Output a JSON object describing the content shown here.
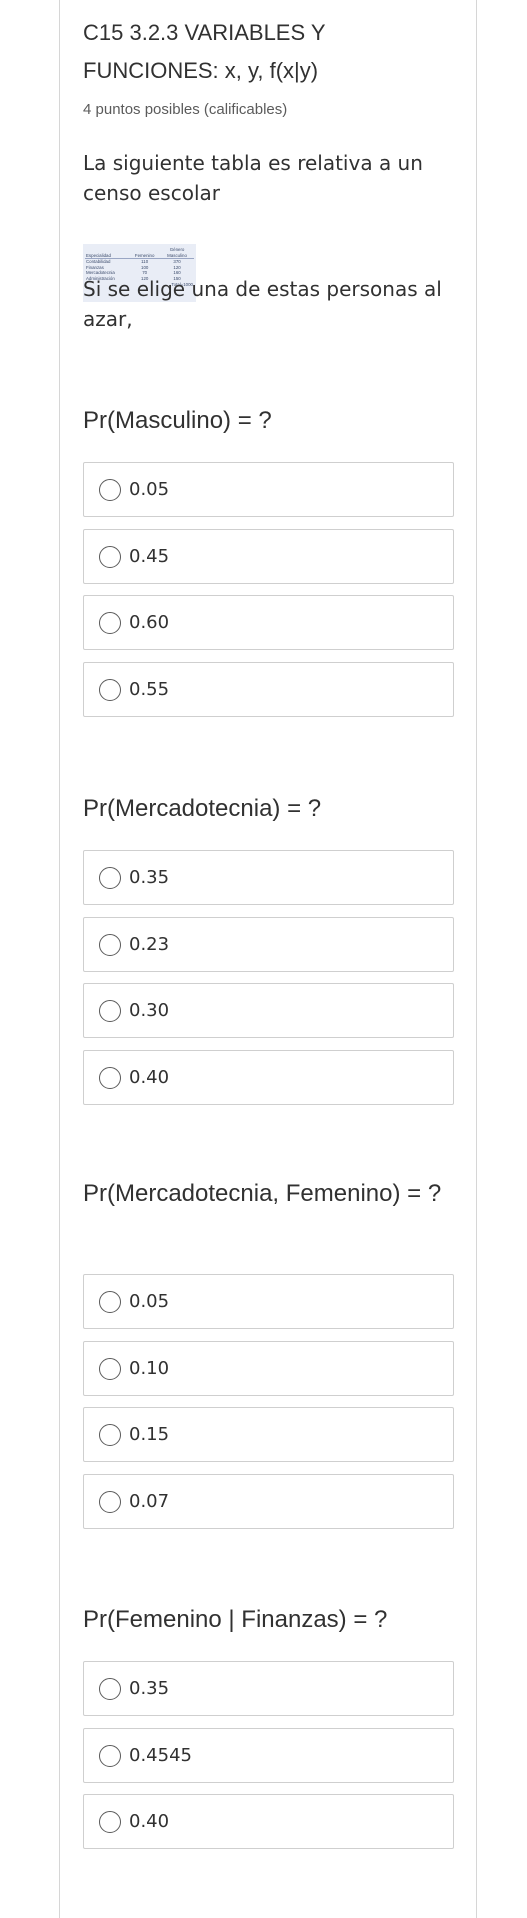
{
  "problem": {
    "title": "C15 3.2.3 VARIABLES Y FUNCIONES: x, y, f(x|y)",
    "points": "4 puntos posibles (calificables)",
    "intro": "La siguiente tabla es relativa a un censo escolar",
    "after_table": "Si se elige una de estas personas al azar,"
  },
  "table": {
    "group_header": "Género",
    "col_especialidad": "Especialidad",
    "col_femenino": "Femenino",
    "col_masculino": "Masculino",
    "rows": [
      {
        "name": "Contabilidad",
        "fem": "110",
        "masc": "370"
      },
      {
        "name": "Finanzas",
        "fem": "100",
        "masc": "120"
      },
      {
        "name": "Mercadotecnia",
        "fem": "70",
        "masc": "160"
      },
      {
        "name": "Administración",
        "fem": "120",
        "masc": "150"
      }
    ],
    "total": "Total=1000"
  },
  "questions": [
    {
      "text": "Pr(Masculino) = ?",
      "options": [
        "0.05",
        "0.45",
        "0.60",
        "0.55"
      ]
    },
    {
      "text": "Pr(Mercadotecnia) = ?",
      "options": [
        "0.35",
        "0.23",
        "0.30",
        "0.40"
      ]
    },
    {
      "text": "Pr(Mercadotecnia, Femenino) = ?",
      "options": [
        "0.05",
        "0.10",
        "0.15",
        "0.07"
      ]
    },
    {
      "text": "Pr(Femenino | Finanzas) = ?",
      "options": [
        "0.35",
        "0.4545",
        "0.40"
      ]
    }
  ]
}
